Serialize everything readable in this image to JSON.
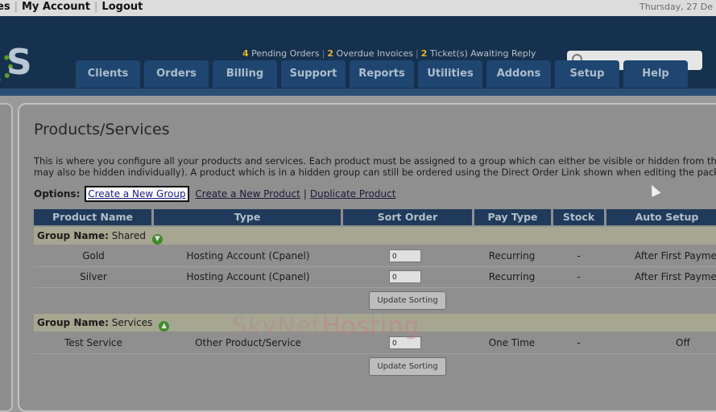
{
  "top": {
    "links": [
      "es",
      "My Account",
      "Logout"
    ],
    "date": "Thursday, 27 De"
  },
  "header": {
    "alerts": {
      "pending_count": "4",
      "pending_label": "Pending Orders",
      "invoice_count": "2",
      "invoice_label": "Overdue Invoices",
      "ticket_count": "2",
      "ticket_label": "Ticket(s) Awaiting Reply"
    },
    "search_placeholder": ""
  },
  "nav": [
    "Clients",
    "Orders",
    "Billing",
    "Support",
    "Reports",
    "Utilities",
    "Addons",
    "Setup",
    "Help"
  ],
  "page": {
    "title": "Products/Services",
    "desc_line1": "This is where you configure all your products and services. Each product must be assigned to a group which can either be visible or hidden from the order",
    "desc_line2": "may also be hidden individually). A product which is in a hidden group can still be ordered using the Direct Order Link shown when editing the package.",
    "options_label": "Options:",
    "create_group": "Create a New Group",
    "create_product": "Create a New Product",
    "duplicate_product": "Duplicate Product",
    "pipe": "|"
  },
  "table": {
    "headers": [
      "Product Name",
      "Type",
      "Sort Order",
      "Pay Type",
      "Stock",
      "Auto Setup"
    ],
    "groups": [
      {
        "label": "Group Name:",
        "name": "Shared",
        "rows": [
          {
            "name": "Gold",
            "type": "Hosting Account (Cpanel)",
            "sort": "0",
            "pay": "Recurring",
            "stock": "-",
            "auto": "After First Paymen"
          },
          {
            "name": "Silver",
            "type": "Hosting Account (Cpanel)",
            "sort": "0",
            "pay": "Recurring",
            "stock": "-",
            "auto": "After First Paymen"
          }
        ]
      },
      {
        "label": "Group Name:",
        "name": "Services",
        "rows": [
          {
            "name": "Test Service",
            "type": "Other Product/Service",
            "sort": "0",
            "pay": "One Time",
            "stock": "-",
            "auto": "Off"
          }
        ]
      }
    ],
    "update_label": "Update Sorting"
  },
  "watermark": {
    "part1": "SkyNet",
    "part2": "Hosting"
  },
  "colors": {
    "nav_bg": "#16314e",
    "tab_bg": "#1e4670",
    "alert_num": "#e4b42a",
    "highlight": "#ffffff"
  }
}
